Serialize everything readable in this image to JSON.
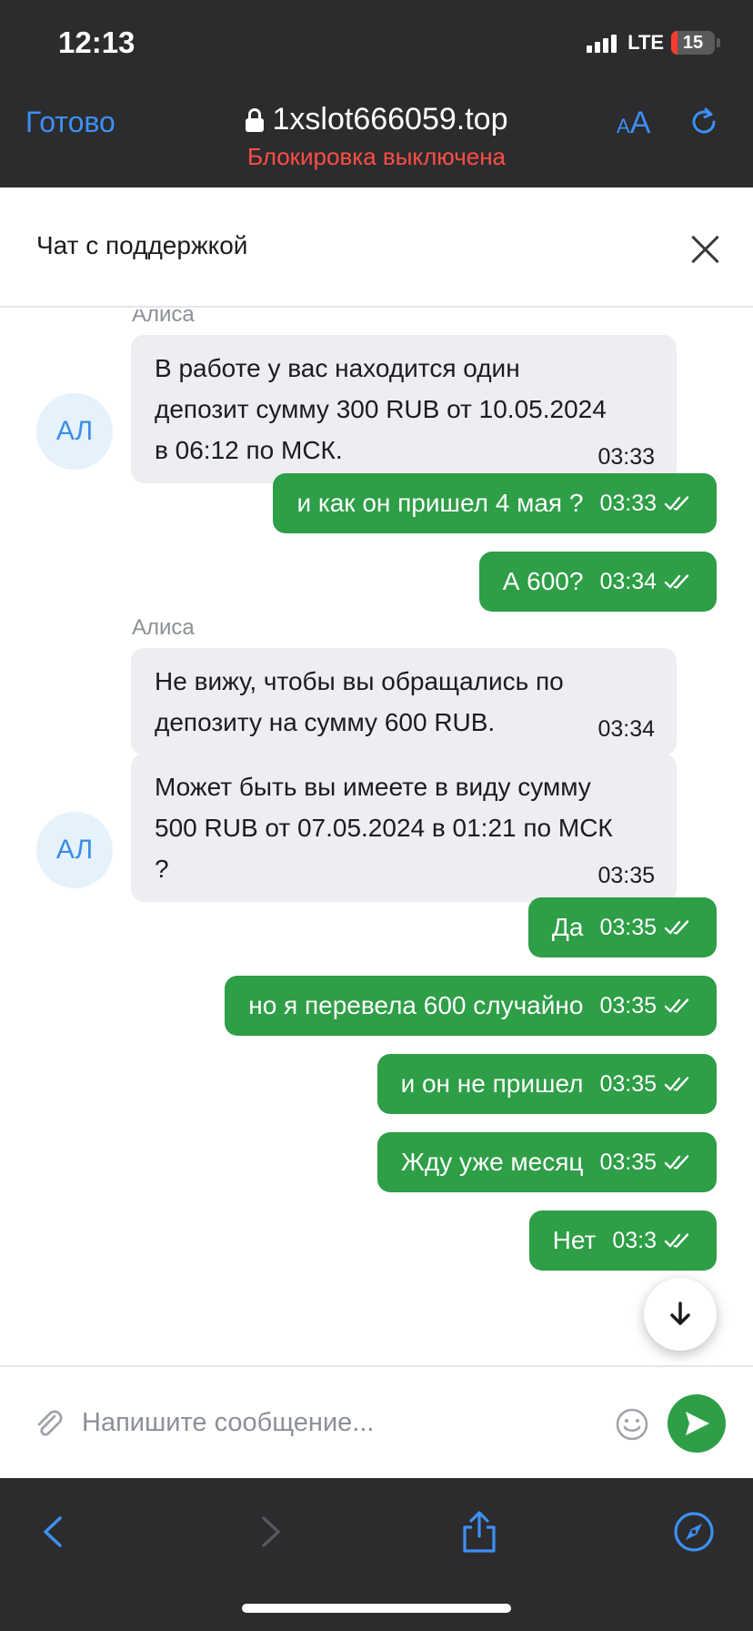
{
  "status_bar": {
    "time": "12:13",
    "network": "LTE",
    "battery": "15",
    "battery_level_percent": 15
  },
  "browser": {
    "done_label": "Готово",
    "url": "1xslot666059.top",
    "subtitle": "Блокировка выключена",
    "text_size_small": "A",
    "text_size_large": "A"
  },
  "chat": {
    "title": "Чат с поддержкой",
    "agent_name": "Алиса",
    "avatar_initials": "АЛ",
    "messages": [
      {
        "direction": "in",
        "lines": [
          "В работе у вас находится один",
          "депозит сумму 300 RUB от 10.05.2024",
          "в 06:12 по МСК."
        ],
        "time": "03:33"
      },
      {
        "direction": "out",
        "text": "и как он пришел 4 мая ?",
        "time": "03:33"
      },
      {
        "direction": "out",
        "text": "А 600?",
        "time": "03:34"
      },
      {
        "direction": "in",
        "lines": [
          "Не вижу, чтобы вы обращались по",
          "депозиту на сумму 600 RUB."
        ],
        "time": "03:34"
      },
      {
        "direction": "in",
        "lines": [
          "Может быть вы имеете в виду сумму",
          "500 RUB от 07.05.2024 в 01:21 по МСК",
          "?"
        ],
        "time": "03:35"
      },
      {
        "direction": "out",
        "text": "Да",
        "time": "03:35"
      },
      {
        "direction": "out",
        "text": "но я перевела 600 случайно",
        "time": "03:35"
      },
      {
        "direction": "out",
        "text": "и он не пришел",
        "time": "03:35"
      },
      {
        "direction": "out",
        "text": "Жду уже месяц",
        "time": "03:35"
      },
      {
        "direction": "out",
        "text": "Нет",
        "time": "03:3"
      }
    ],
    "input_placeholder": "Напишите сообщение..."
  },
  "colors": {
    "accent_blue": "#3d8ff5",
    "outgoing_green": "#2e9e47",
    "incoming_gray": "#eceef1",
    "warning_red": "#ff4d44"
  }
}
